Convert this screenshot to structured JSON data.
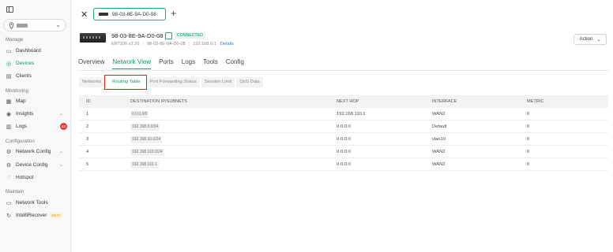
{
  "sidebar": {
    "sections": {
      "manage": "Manage",
      "monitoring": "Monitoring",
      "configuration": "Configuration",
      "maintain": "Maintain"
    },
    "items": {
      "dashboard": "Dashboard",
      "devices": "Devices",
      "clients": "Clients",
      "map": "Map",
      "insights": "Insights",
      "logs": "Logs",
      "logs_badge": "62",
      "network_config": "Network Config",
      "device_config": "Device Config",
      "hotspot": "Hotspot",
      "network_tools": "Network Tools",
      "intellirecover": "IntelliRecover",
      "beta": "BETA"
    }
  },
  "header": {
    "device_tab": "98-03-8E-9A-D0-08"
  },
  "device": {
    "name": "98-03-8E-9A-D0-08",
    "status": "CONNECTED",
    "model": "ER7206 v2.20",
    "mac": "98-03-8E-9A-D0-08",
    "ip": "192.168.0.1",
    "details_link": "Details",
    "action_label": "Action"
  },
  "tabs": [
    "Overview",
    "Network View",
    "Ports",
    "Logs",
    "Tools",
    "Config"
  ],
  "subtabs": [
    "Networks",
    "Routing Table",
    "Port Forwarding Status",
    "Session Limit",
    "QoS Data"
  ],
  "table": {
    "columns": [
      "ID",
      "DESTINATION IP/SUBNETS",
      "NEXT HOP",
      "INTERFACE",
      "METRIC"
    ],
    "rows": [
      {
        "id": "1",
        "dest": "0.0.0.0/0",
        "next_hop": "192.168.110.1",
        "iface": "WAN2",
        "metric": "0"
      },
      {
        "id": "2",
        "dest": "192.168.0.0/24",
        "next_hop": "0.0.0.0",
        "iface": "Default",
        "metric": "0"
      },
      {
        "id": "3",
        "dest": "192.168.10.0/24",
        "next_hop": "0.0.0.0",
        "iface": "vlan10",
        "metric": "0"
      },
      {
        "id": "4",
        "dest": "192.168.110.0/24",
        "next_hop": "0.0.0.0",
        "iface": "WAN2",
        "metric": "0"
      },
      {
        "id": "5",
        "dest": "192.168.110.1",
        "next_hop": "0.0.0.0",
        "iface": "WAN2",
        "metric": "0"
      }
    ]
  },
  "colors": {
    "accent": "#0a9a6b",
    "highlight": "#d9261c",
    "badge": "#e23b3b"
  }
}
